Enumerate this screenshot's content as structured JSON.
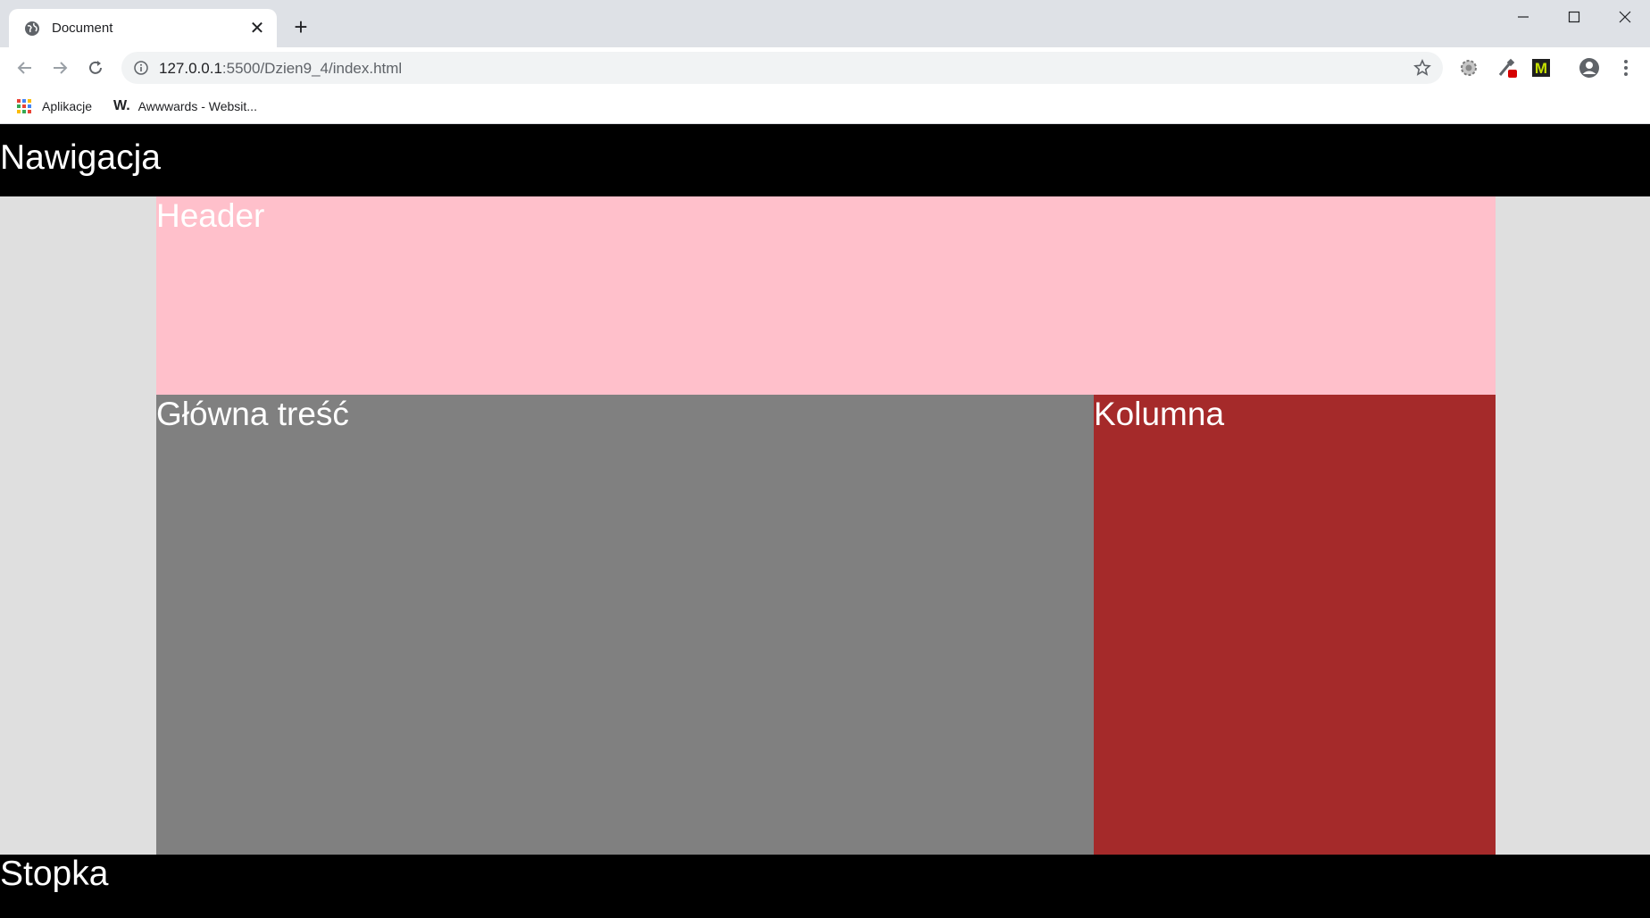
{
  "browser": {
    "tab_title": "Document",
    "url_host": "127.0.0.1",
    "url_rest": ":5500/Dzien9_4/index.html",
    "bookmarks": [
      {
        "label": "Aplikacje",
        "icon": "apps-grid-icon"
      },
      {
        "label": "Awwwards - Websit...",
        "icon": "awwwards-w-icon"
      }
    ]
  },
  "page": {
    "nav": "Nawigacja",
    "header": "Header",
    "main": "Główna treść",
    "aside": "Kolumna",
    "footer": "Stopka"
  },
  "colors": {
    "nav_bg": "#000000",
    "header_bg": "#ffc0cb",
    "main_bg": "#808080",
    "aside_bg": "#a52a2a",
    "page_bg": "#dfdfdf",
    "text": "#ffffff"
  }
}
